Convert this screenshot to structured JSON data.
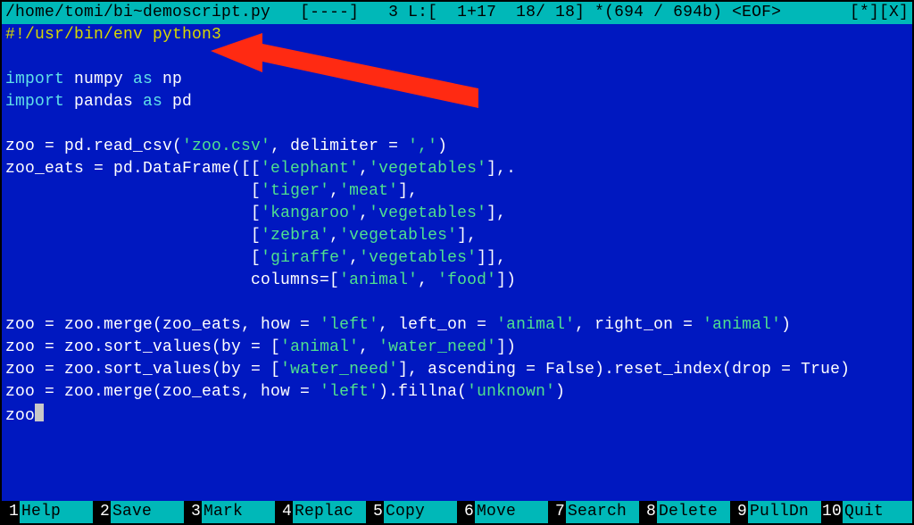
{
  "status": {
    "path": "/home/tomi/bi~demoscript.py",
    "flags": "[----]",
    "pos": "3 L:[  1+17  18/ 18] *(694 / 694b) <EOF>",
    "right": "[*][X]"
  },
  "code": {
    "l01_shebang": "#!/usr/bin/env python3",
    "l03_import": "import",
    "l03_numpy": " numpy ",
    "l03_as": "as",
    "l03_np": " np",
    "l04_import": "import",
    "l04_pandas": " pandas ",
    "l04_as": "as",
    "l04_pd": " pd",
    "l06a": "zoo = pd.read_csv(",
    "l06s": "'zoo.csv'",
    "l06b": ", delimiter = ",
    "l06c": "','",
    "l06d": ")",
    "l07a": "zoo_eats = pd.DataFrame([[",
    "l07s1": "'elephant'",
    "l07s2": "'vegetables'",
    "l07tail": "],.",
    "pad25": "                         ",
    "l08a": "[",
    "l08s1": "'tiger'",
    "l08s2": "'meat'",
    "l08b": "],",
    "l09s1": "'kangaroo'",
    "l09s2": "'vegetables'",
    "l10s1": "'zebra'",
    "l10s2": "'vegetables'",
    "l11s1": "'giraffe'",
    "l11s2": "'vegetables'",
    "l11b": "]],",
    "l12a": "columns=[",
    "l12s1": "'animal'",
    "l12s2": "'food'",
    "l12b": "])",
    "l14a": "zoo = zoo.merge(zoo_eats, how = ",
    "l14s1": "'left'",
    "l14b": ", left_on = ",
    "l14s2": "'animal'",
    "l14c": ", right_on = ",
    "l14s3": "'animal'",
    "l14d": ")",
    "l15a": "zoo = zoo.sort_values(by = [",
    "l15s1": "'animal'",
    "l15s2": "'water_need'",
    "l15b": "])",
    "l16a": "zoo = zoo.sort_values(by = [",
    "l16s1": "'water_need'",
    "l16b": "], ascending = False).reset_index(drop = True)",
    "l17a": "zoo = zoo.merge(zoo_eats, how = ",
    "l17s1": "'left'",
    "l17b": ").fillna(",
    "l17s2": "'unknown'",
    "l17c": ")",
    "l18": "zoo"
  },
  "fkeys": [
    {
      "n": "1",
      "label": "Help"
    },
    {
      "n": "2",
      "label": "Save"
    },
    {
      "n": "3",
      "label": "Mark"
    },
    {
      "n": "4",
      "label": "Replac"
    },
    {
      "n": "5",
      "label": "Copy"
    },
    {
      "n": "6",
      "label": "Move"
    },
    {
      "n": "7",
      "label": "Search"
    },
    {
      "n": "8",
      "label": "Delete"
    },
    {
      "n": "9",
      "label": "PullDn"
    },
    {
      "n": "10",
      "label": "Quit"
    }
  ],
  "arrow": {
    "color": "#ff2a12"
  }
}
